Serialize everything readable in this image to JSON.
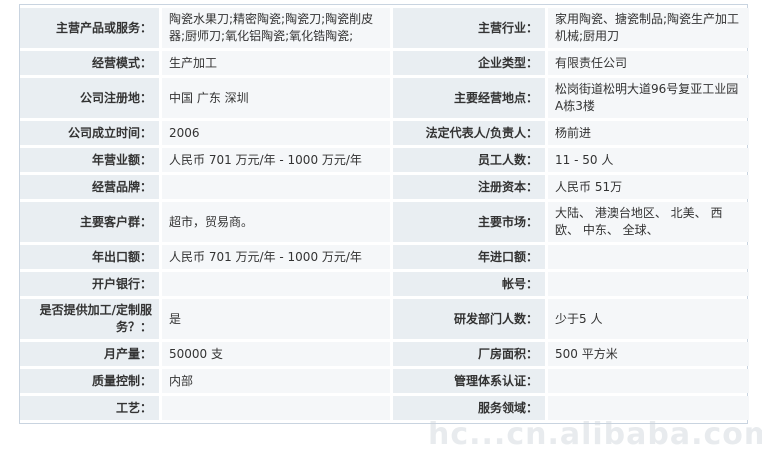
{
  "rows": [
    {
      "l1": "主营产品或服务：",
      "v1": "陶瓷水果刀;精密陶瓷;陶瓷刀;陶瓷削皮器;厨师刀;氧化铝陶瓷;氧化锆陶瓷;",
      "l2": "主营行业：",
      "v2": "家用陶瓷、搪瓷制品;陶瓷生产加工机械;厨用刀",
      "h": 40
    },
    {
      "l1": "经营模式：",
      "v1": "生产加工",
      "l2": "企业类型：",
      "v2": "有限责任公司",
      "h": 24
    },
    {
      "l1": "公司注册地：",
      "v1": "中国  广东  深圳",
      "l2": "主要经营地点：",
      "v2": "松岗街道松明大道96号复亚工业园A栋3楼",
      "h": 40
    },
    {
      "l1": "公司成立时间：",
      "v1": "2006",
      "l2": "法定代表人/负责人：",
      "v2": "杨前进",
      "h": 24
    },
    {
      "l1": "年营业额：",
      "v1": "人民币  701 万元/年  - 1000 万元/年",
      "l2": "员工人数：",
      "v2": "11 - 50 人",
      "h": 24
    },
    {
      "l1": "经营品牌：",
      "v1": "",
      "l2": "注册资本：",
      "v2": "人民币  51万",
      "h": 24
    },
    {
      "l1": "主要客户群：",
      "v1": "超市，贸易商。",
      "l2": "主要市场：",
      "v2": "大陆、  港澳台地区、  北美、  西欧、  中东、  全球、",
      "h": 40
    },
    {
      "l1": "年出口额：",
      "v1": "人民币  701 万元/年  - 1000 万元/年",
      "l2": "年进口额：",
      "v2": "",
      "h": 24
    },
    {
      "l1": "开户银行：",
      "v1": "",
      "l2": "帐号：",
      "v2": "",
      "h": 24
    },
    {
      "l1": "是否提供加工/定制服务？：",
      "v1": "是",
      "l2": "研发部门人数：",
      "v2": "少于5 人",
      "h": 40
    },
    {
      "l1": "月产量：",
      "v1": "50000 支",
      "l2": "厂房面积：",
      "v2": "500 平方米",
      "h": 24
    },
    {
      "l1": "质量控制：",
      "v1": "内部",
      "l2": "管理体系认证：",
      "v2": "",
      "h": 24
    },
    {
      "l1": "工艺：",
      "v1": "",
      "l2": "服务领域：",
      "v2": "",
      "h": 24
    }
  ],
  "watermark": "hc...cn.alibaba.com"
}
